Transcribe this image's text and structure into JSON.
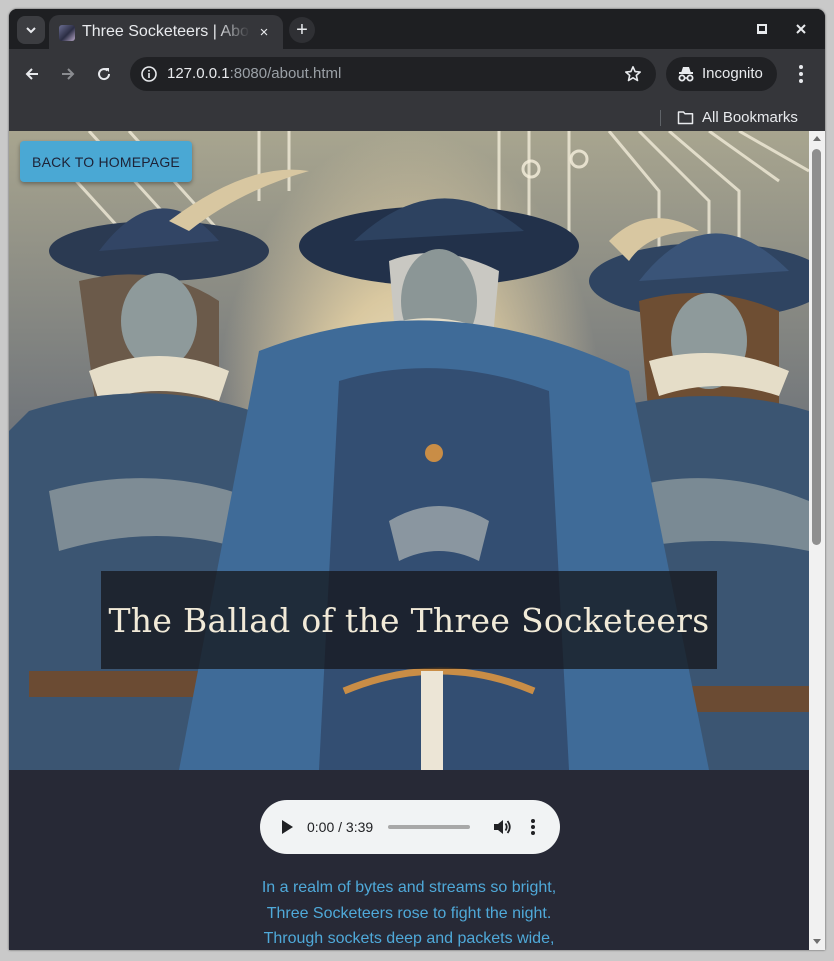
{
  "browser": {
    "tab_title": "Three Socketeers | About",
    "url_host": "127.0.0.1",
    "url_rest": ":8080/about.html",
    "profile_label": "Incognito",
    "bookmarks_label": "All Bookmarks",
    "new_tab_symbol": "+",
    "close_symbol": "×"
  },
  "page": {
    "back_button": "Back to Homepage",
    "title": "The Ballad of the Three Socketeers",
    "hero_image": "three-socketeers-illustration",
    "audio": {
      "current_time": "0:00",
      "duration": "3:39",
      "time_display": "0:00 / 3:39",
      "progress": 0
    },
    "lyrics": [
      "In a realm of bytes and streams so bright,",
      "Three Socketeers rose to fight the night.",
      "Through sockets deep and packets wide,"
    ]
  },
  "colors": {
    "button_bg": "#4aa8d4",
    "lyrics_text": "#4fa9d9",
    "page_bg": "#272936",
    "browser_chrome": "#35363a"
  },
  "icons": {
    "tab_search": "chevron-down-icon",
    "back": "arrow-left-icon",
    "forward": "arrow-right-icon",
    "reload": "reload-icon",
    "site_info": "info-icon",
    "bookmark": "star-icon",
    "incognito": "incognito-icon",
    "menu": "kebab-menu-icon",
    "folder": "folder-icon",
    "play": "play-icon",
    "volume": "volume-icon"
  }
}
